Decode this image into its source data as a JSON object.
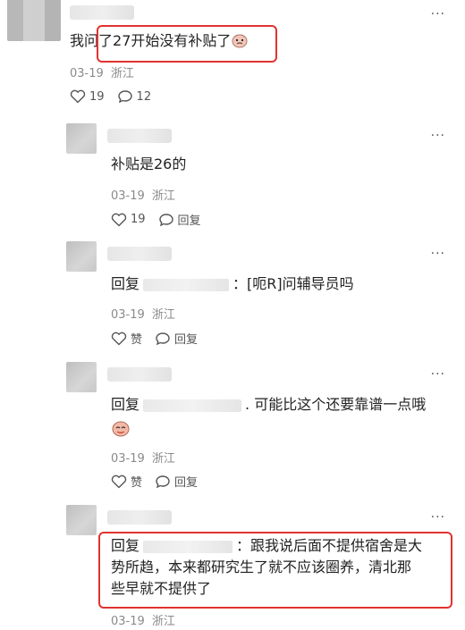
{
  "comments": [
    {
      "text_prefix": "我问",
      "text_main": "了27开始没有补贴了",
      "date": "03-19",
      "location": "浙江",
      "likes": "19",
      "replies": "12"
    },
    {
      "text": "补贴是26的",
      "date": "03-19",
      "location": "浙江",
      "likes": "19",
      "reply_label": "回复"
    },
    {
      "reply_prefix": "回复",
      "text": "：[呃R]问辅导员吗",
      "date": "03-19",
      "location": "浙江",
      "like_label": "赞",
      "reply_label": "回复"
    },
    {
      "reply_prefix": "回复",
      "text": ". 可能比这个还要靠谱一点哦",
      "date": "03-19",
      "location": "浙江",
      "like_label": "赞",
      "reply_label": "回复"
    },
    {
      "reply_prefix": "回复",
      "text_line1": "：跟我说后面不提供宿舍是大",
      "text_line2": "势所趋，本来都研究生了就不应该圈养，清北那",
      "text_line3": "些早就不提供了",
      "date": "03-19",
      "location": "浙江"
    }
  ],
  "icons": {
    "more": "more-dots-icon",
    "like": "heart-outline-icon",
    "reply": "comment-bubble-icon",
    "emoji": "face-emoji-icon"
  },
  "colors": {
    "highlight": "#e0332f",
    "meta": "#8a8a8a"
  },
  "more_glyph": "···"
}
